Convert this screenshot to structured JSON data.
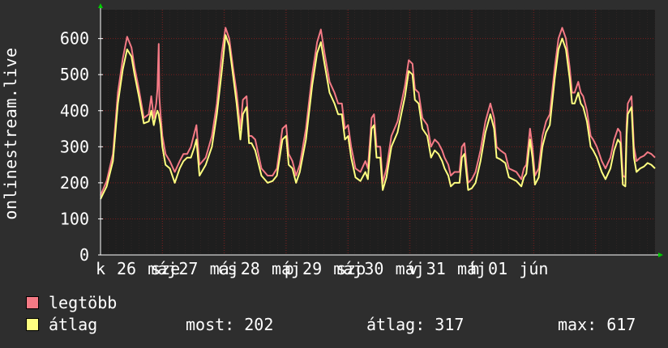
{
  "ylabel": "onlinestream.live",
  "legend": [
    {
      "name": "legtöbb",
      "color": "#f47a85"
    },
    {
      "name": "átlag",
      "color": "#ffff80"
    }
  ],
  "stats": {
    "now_label": "most:",
    "now_value": "202",
    "avg_label": "átlag:",
    "avg_value": "317",
    "max_label": "max:",
    "max_value": "617"
  },
  "colors": {
    "background": "#2e2e2e",
    "plot": "#1e1e1e",
    "grid": "#7a1f1f",
    "axis": "#ffffff",
    "arrow": "#00cc00"
  },
  "chart_data": {
    "type": "line",
    "xlim": [
      0,
      8
    ],
    "ylim": [
      0,
      680
    ],
    "yticks": [
      0,
      100,
      200,
      300,
      400,
      500,
      600
    ],
    "xtick_labels": [
      {
        "x": 0.0,
        "text": "k"
      },
      {
        "x": 0.42,
        "text": "26"
      },
      {
        "x": 1.0,
        "text": "máj"
      },
      {
        "x": 1.05,
        "text": "sze"
      },
      {
        "x": 1.42,
        "text": "27"
      },
      {
        "x": 2.0,
        "text": "máj"
      },
      {
        "x": 2.05,
        "text": "cs"
      },
      {
        "x": 2.42,
        "text": "28"
      },
      {
        "x": 3.0,
        "text": "máj"
      },
      {
        "x": 3.05,
        "text": "p"
      },
      {
        "x": 3.42,
        "text": "29"
      },
      {
        "x": 4.0,
        "text": "máj"
      },
      {
        "x": 4.05,
        "text": "szo"
      },
      {
        "x": 4.42,
        "text": "30"
      },
      {
        "x": 5.0,
        "text": "máj"
      },
      {
        "x": 5.05,
        "text": "v"
      },
      {
        "x": 5.42,
        "text": "31"
      },
      {
        "x": 6.0,
        "text": "máj"
      },
      {
        "x": 6.05,
        "text": "h"
      },
      {
        "x": 6.42,
        "text": "01"
      },
      {
        "x": 7.0,
        "text": "jún"
      }
    ],
    "series": [
      {
        "name": "legtöbb",
        "color": "#f47a85",
        "points": [
          [
            0,
            165
          ],
          [
            0.1,
            205
          ],
          [
            0.2,
            280
          ],
          [
            0.28,
            450
          ],
          [
            0.36,
            545
          ],
          [
            0.43,
            605
          ],
          [
            0.5,
            575
          ],
          [
            0.55,
            520
          ],
          [
            0.62,
            460
          ],
          [
            0.7,
            380
          ],
          [
            0.78,
            390
          ],
          [
            0.82,
            440
          ],
          [
            0.86,
            380
          ],
          [
            0.9,
            420
          ],
          [
            0.92,
            460
          ],
          [
            0.94,
            585
          ],
          [
            0.95,
            440
          ],
          [
            0.97,
            390
          ],
          [
            1.0,
            330
          ],
          [
            1.05,
            280
          ],
          [
            1.12,
            260
          ],
          [
            1.2,
            230
          ],
          [
            1.28,
            260
          ],
          [
            1.34,
            280
          ],
          [
            1.4,
            280
          ],
          [
            1.46,
            300
          ],
          [
            1.52,
            340
          ],
          [
            1.55,
            360
          ],
          [
            1.6,
            250
          ],
          [
            1.7,
            270
          ],
          [
            1.8,
            330
          ],
          [
            1.88,
            420
          ],
          [
            1.96,
            560
          ],
          [
            2.02,
            630
          ],
          [
            2.08,
            600
          ],
          [
            2.14,
            520
          ],
          [
            2.2,
            450
          ],
          [
            2.26,
            350
          ],
          [
            2.3,
            430
          ],
          [
            2.36,
            440
          ],
          [
            2.4,
            330
          ],
          [
            2.44,
            330
          ],
          [
            2.5,
            320
          ],
          [
            2.6,
            240
          ],
          [
            2.7,
            220
          ],
          [
            2.78,
            220
          ],
          [
            2.85,
            240
          ],
          [
            2.94,
            350
          ],
          [
            3.0,
            360
          ],
          [
            3.04,
            280
          ],
          [
            3.1,
            260
          ],
          [
            3.16,
            220
          ],
          [
            3.22,
            250
          ],
          [
            3.32,
            350
          ],
          [
            3.42,
            500
          ],
          [
            3.5,
            590
          ],
          [
            3.56,
            625
          ],
          [
            3.62,
            560
          ],
          [
            3.7,
            480
          ],
          [
            3.78,
            450
          ],
          [
            3.84,
            420
          ],
          [
            3.9,
            420
          ],
          [
            3.95,
            350
          ],
          [
            4.0,
            360
          ],
          [
            4.05,
            300
          ],
          [
            4.12,
            240
          ],
          [
            4.2,
            230
          ],
          [
            4.28,
            260
          ],
          [
            4.32,
            240
          ],
          [
            4.38,
            380
          ],
          [
            4.42,
            390
          ],
          [
            4.46,
            300
          ],
          [
            4.52,
            300
          ],
          [
            4.56,
            200
          ],
          [
            4.62,
            240
          ],
          [
            4.7,
            330
          ],
          [
            4.8,
            370
          ],
          [
            4.86,
            420
          ],
          [
            4.92,
            470
          ],
          [
            4.98,
            540
          ],
          [
            5.04,
            530
          ],
          [
            5.08,
            460
          ],
          [
            5.14,
            450
          ],
          [
            5.2,
            380
          ],
          [
            5.28,
            360
          ],
          [
            5.34,
            300
          ],
          [
            5.4,
            320
          ],
          [
            5.46,
            310
          ],
          [
            5.52,
            290
          ],
          [
            5.56,
            270
          ],
          [
            5.62,
            250
          ],
          [
            5.66,
            220
          ],
          [
            5.72,
            230
          ],
          [
            5.8,
            230
          ],
          [
            5.84,
            300
          ],
          [
            5.88,
            310
          ],
          [
            5.94,
            200
          ],
          [
            6.0,
            210
          ],
          [
            6.06,
            230
          ],
          [
            6.14,
            290
          ],
          [
            6.22,
            370
          ],
          [
            6.3,
            420
          ],
          [
            6.36,
            380
          ],
          [
            6.4,
            300
          ],
          [
            6.46,
            290
          ],
          [
            6.54,
            280
          ],
          [
            6.6,
            240
          ],
          [
            6.66,
            235
          ],
          [
            6.72,
            230
          ],
          [
            6.8,
            210
          ],
          [
            6.84,
            240
          ],
          [
            6.88,
            250
          ],
          [
            6.94,
            350
          ],
          [
            6.98,
            300
          ],
          [
            7.02,
            220
          ],
          [
            7.08,
            240
          ],
          [
            7.14,
            330
          ],
          [
            7.2,
            370
          ],
          [
            7.26,
            390
          ],
          [
            7.34,
            520
          ],
          [
            7.4,
            600
          ],
          [
            7.46,
            630
          ],
          [
            7.52,
            600
          ],
          [
            7.58,
            520
          ],
          [
            7.62,
            450
          ],
          [
            7.66,
            450
          ],
          [
            7.72,
            480
          ],
          [
            7.76,
            450
          ],
          [
            7.8,
            440
          ],
          [
            7.86,
            400
          ],
          [
            7.92,
            330
          ],
          [
            7.96,
            320
          ],
          [
            8.02,
            300
          ],
          [
            8.1,
            260
          ],
          [
            8.16,
            240
          ],
          [
            8.24,
            270
          ],
          [
            8.3,
            320
          ],
          [
            8.36,
            350
          ],
          [
            8.4,
            340
          ],
          [
            8.44,
            220
          ],
          [
            8.48,
            215
          ],
          [
            8.5,
            360
          ],
          [
            8.52,
            420
          ],
          [
            8.58,
            440
          ],
          [
            8.62,
            300
          ],
          [
            8.66,
            260
          ],
          [
            8.72,
            270
          ],
          [
            8.78,
            275
          ],
          [
            8.84,
            285
          ],
          [
            8.9,
            280
          ],
          [
            8.96,
            270
          ]
        ]
      },
      {
        "name": "átlag",
        "color": "#ffff80",
        "points": [
          [
            0,
            155
          ],
          [
            0.1,
            190
          ],
          [
            0.2,
            260
          ],
          [
            0.28,
            420
          ],
          [
            0.36,
            515
          ],
          [
            0.43,
            570
          ],
          [
            0.5,
            550
          ],
          [
            0.55,
            500
          ],
          [
            0.62,
            440
          ],
          [
            0.7,
            365
          ],
          [
            0.78,
            370
          ],
          [
            0.82,
            400
          ],
          [
            0.86,
            360
          ],
          [
            0.9,
            390
          ],
          [
            0.92,
            400
          ],
          [
            0.94,
            390
          ],
          [
            0.95,
            380
          ],
          [
            0.97,
            360
          ],
          [
            1.0,
            300
          ],
          [
            1.05,
            250
          ],
          [
            1.12,
            240
          ],
          [
            1.2,
            200
          ],
          [
            1.28,
            240
          ],
          [
            1.34,
            260
          ],
          [
            1.4,
            270
          ],
          [
            1.46,
            270
          ],
          [
            1.52,
            300
          ],
          [
            1.55,
            320
          ],
          [
            1.6,
            220
          ],
          [
            1.7,
            250
          ],
          [
            1.8,
            300
          ],
          [
            1.88,
            390
          ],
          [
            1.96,
            510
          ],
          [
            2.02,
            610
          ],
          [
            2.08,
            580
          ],
          [
            2.14,
            500
          ],
          [
            2.2,
            420
          ],
          [
            2.26,
            320
          ],
          [
            2.3,
            390
          ],
          [
            2.36,
            410
          ],
          [
            2.4,
            310
          ],
          [
            2.44,
            310
          ],
          [
            2.5,
            290
          ],
          [
            2.6,
            220
          ],
          [
            2.7,
            200
          ],
          [
            2.78,
            205
          ],
          [
            2.85,
            220
          ],
          [
            2.94,
            320
          ],
          [
            3.0,
            330
          ],
          [
            3.04,
            250
          ],
          [
            3.1,
            240
          ],
          [
            3.16,
            200
          ],
          [
            3.22,
            230
          ],
          [
            3.32,
            320
          ],
          [
            3.42,
            470
          ],
          [
            3.5,
            560
          ],
          [
            3.56,
            590
          ],
          [
            3.62,
            530
          ],
          [
            3.7,
            450
          ],
          [
            3.78,
            420
          ],
          [
            3.84,
            390
          ],
          [
            3.9,
            390
          ],
          [
            3.95,
            320
          ],
          [
            4.0,
            330
          ],
          [
            4.05,
            270
          ],
          [
            4.12,
            215
          ],
          [
            4.2,
            205
          ],
          [
            4.28,
            230
          ],
          [
            4.32,
            210
          ],
          [
            4.38,
            350
          ],
          [
            4.42,
            360
          ],
          [
            4.46,
            270
          ],
          [
            4.52,
            270
          ],
          [
            4.56,
            180
          ],
          [
            4.62,
            215
          ],
          [
            4.7,
            300
          ],
          [
            4.8,
            340
          ],
          [
            4.86,
            390
          ],
          [
            4.92,
            440
          ],
          [
            4.98,
            510
          ],
          [
            5.04,
            500
          ],
          [
            5.08,
            430
          ],
          [
            5.14,
            420
          ],
          [
            5.2,
            350
          ],
          [
            5.28,
            330
          ],
          [
            5.34,
            270
          ],
          [
            5.4,
            290
          ],
          [
            5.46,
            280
          ],
          [
            5.52,
            260
          ],
          [
            5.56,
            240
          ],
          [
            5.62,
            220
          ],
          [
            5.66,
            190
          ],
          [
            5.72,
            200
          ],
          [
            5.8,
            200
          ],
          [
            5.84,
            270
          ],
          [
            5.88,
            280
          ],
          [
            5.94,
            180
          ],
          [
            6.0,
            185
          ],
          [
            6.06,
            200
          ],
          [
            6.14,
            260
          ],
          [
            6.22,
            340
          ],
          [
            6.3,
            390
          ],
          [
            6.36,
            350
          ],
          [
            6.4,
            270
          ],
          [
            6.46,
            265
          ],
          [
            6.54,
            255
          ],
          [
            6.6,
            215
          ],
          [
            6.66,
            210
          ],
          [
            6.72,
            205
          ],
          [
            6.8,
            190
          ],
          [
            6.84,
            215
          ],
          [
            6.88,
            225
          ],
          [
            6.94,
            320
          ],
          [
            6.98,
            270
          ],
          [
            7.02,
            195
          ],
          [
            7.08,
            215
          ],
          [
            7.14,
            300
          ],
          [
            7.2,
            340
          ],
          [
            7.26,
            360
          ],
          [
            7.34,
            490
          ],
          [
            7.4,
            570
          ],
          [
            7.46,
            600
          ],
          [
            7.52,
            570
          ],
          [
            7.58,
            490
          ],
          [
            7.62,
            420
          ],
          [
            7.66,
            420
          ],
          [
            7.72,
            450
          ],
          [
            7.76,
            420
          ],
          [
            7.8,
            410
          ],
          [
            7.86,
            370
          ],
          [
            7.92,
            300
          ],
          [
            7.96,
            290
          ],
          [
            8.02,
            270
          ],
          [
            8.1,
            230
          ],
          [
            8.16,
            210
          ],
          [
            8.24,
            240
          ],
          [
            8.3,
            290
          ],
          [
            8.36,
            320
          ],
          [
            8.4,
            310
          ],
          [
            8.44,
            195
          ],
          [
            8.48,
            190
          ],
          [
            8.5,
            330
          ],
          [
            8.52,
            390
          ],
          [
            8.58,
            410
          ],
          [
            8.62,
            270
          ],
          [
            8.66,
            230
          ],
          [
            8.72,
            240
          ],
          [
            8.78,
            245
          ],
          [
            8.84,
            255
          ],
          [
            8.9,
            250
          ],
          [
            8.96,
            240
          ]
        ]
      }
    ]
  }
}
